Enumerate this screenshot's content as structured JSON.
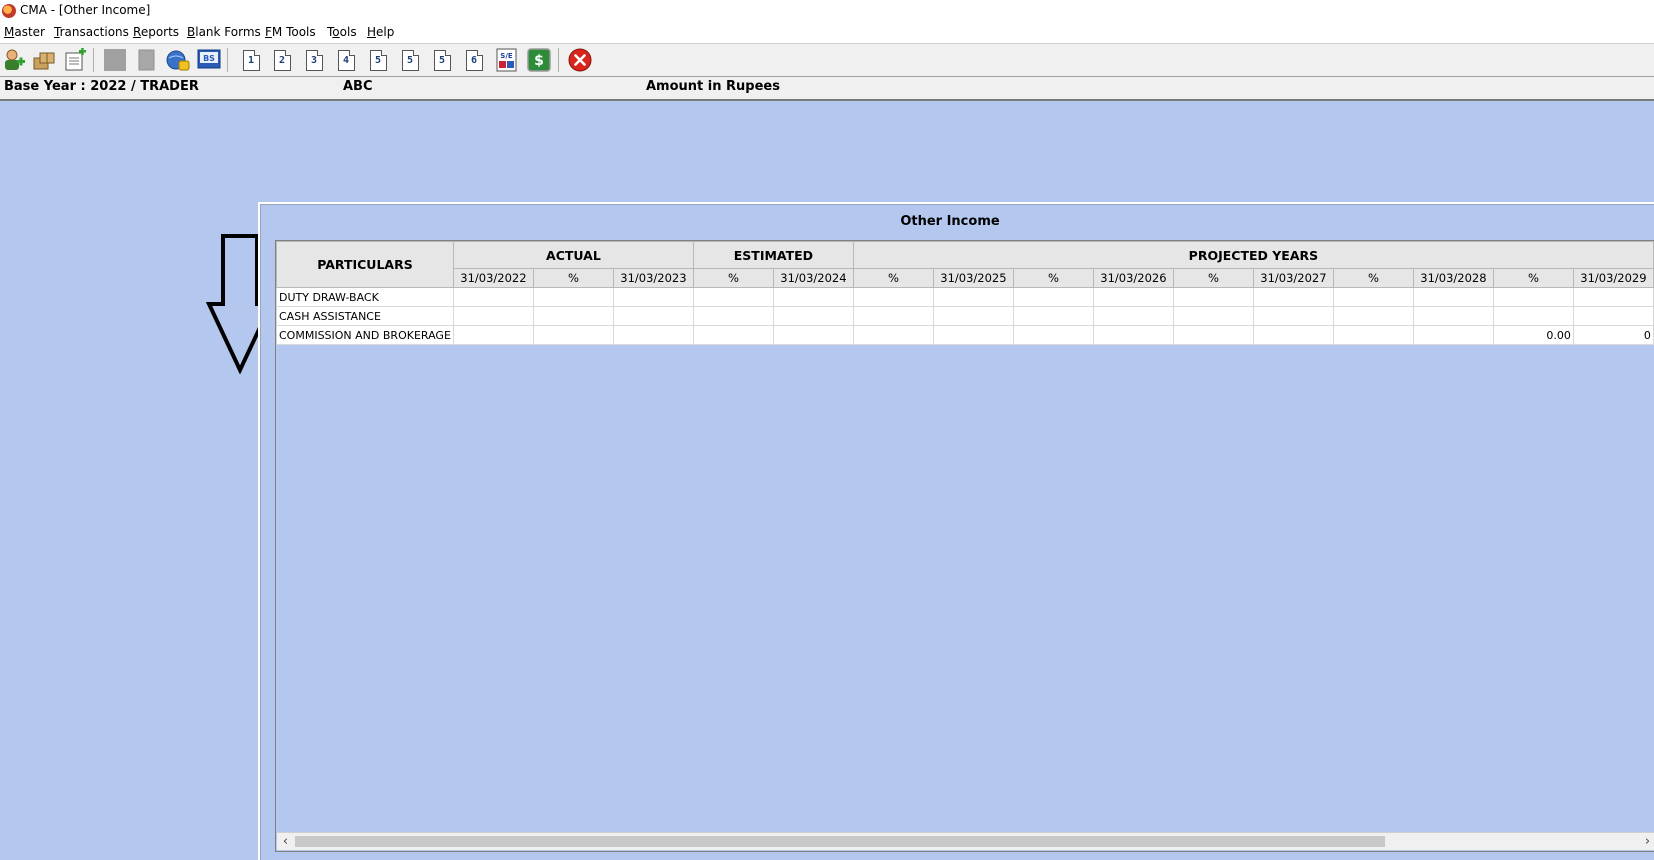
{
  "window": {
    "title": "CMA - [Other Income]"
  },
  "menu": [
    {
      "pre": "",
      "u": "M",
      "post": "aster"
    },
    {
      "pre": "",
      "u": "T",
      "post": "ransactions"
    },
    {
      "pre": "",
      "u": "R",
      "post": "eports"
    },
    {
      "pre": "",
      "u": "B",
      "post": "lank Forms"
    },
    {
      "pre": "",
      "u": "F",
      "post": "M Tools"
    },
    {
      "pre": "T",
      "u": "o",
      "post": "ols"
    },
    {
      "pre": "",
      "u": "H",
      "post": "elp"
    }
  ],
  "toolbar": {
    "number_labels": [
      "1",
      "2",
      "3",
      "4",
      "5",
      "5",
      "5",
      "6"
    ],
    "bs_label": "BS",
    "ratio_label": "S/E",
    "currency_symbol": "$"
  },
  "info": {
    "base_year": "Base Year : 2022 / TRADER",
    "company": "ABC",
    "amount_unit": "Amount in Rupees"
  },
  "panel": {
    "title": "Other Income"
  },
  "grid": {
    "particulars_header": "PARTICULARS",
    "groups": {
      "actual": "ACTUAL",
      "estimated": "ESTIMATED",
      "projected": "PROJECTED YEARS"
    },
    "columns": [
      "31/03/2022",
      "%",
      "31/03/2023",
      "%",
      "31/03/2024",
      "%",
      "31/03/2025",
      "%",
      "31/03/2026",
      "%",
      "31/03/2027",
      "%",
      "31/03/2028",
      "%",
      "31/03/2029"
    ],
    "rows": [
      {
        "label": "DUTY DRAW-BACK",
        "cells": [
          "",
          "",
          "",
          "",
          "",
          "",
          "",
          "",
          "",
          "",
          "",
          "",
          "",
          "",
          ""
        ]
      },
      {
        "label": "CASH ASSISTANCE",
        "cells": [
          "",
          "",
          "",
          "",
          "",
          "",
          "",
          "",
          "",
          "",
          "",
          "",
          "",
          "",
          ""
        ]
      },
      {
        "label": "COMMISSION AND BROKERAGE",
        "cells": [
          "",
          "",
          "",
          "",
          "",
          "",
          "",
          "",
          "",
          "",
          "",
          "",
          "",
          "0.00",
          "0"
        ]
      }
    ]
  },
  "colors": {
    "background": "#b4c8ef",
    "close": "#d9261c",
    "arrow": "#000000"
  }
}
